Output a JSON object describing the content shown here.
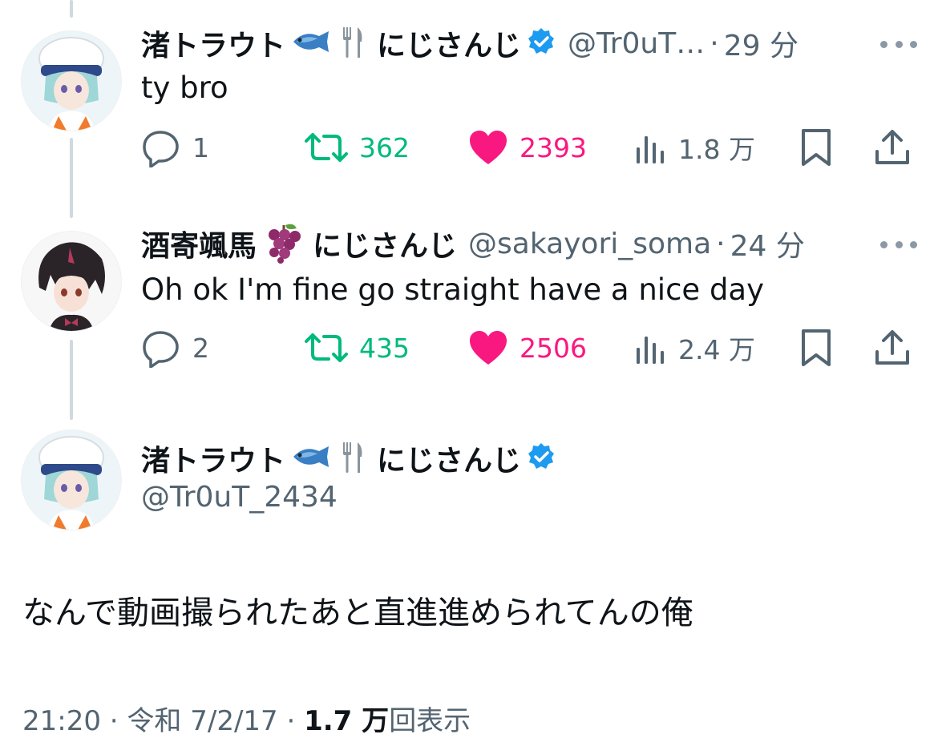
{
  "thread": [
    {
      "display_name": "渚トラウト",
      "suffix": "にじさんじ",
      "handle": "@Tr0uT…",
      "separator": "·",
      "time": "29 分",
      "text": "ty bro",
      "reply_count": "1",
      "retweet_count": "362",
      "like_count": "2393",
      "view_count": "1.8 万",
      "verified": true,
      "name_emojis": [
        "fish-icon",
        "fork-knife-icon"
      ]
    },
    {
      "display_name": "酒寄颯馬",
      "suffix": "にじさんじ",
      "handle": "@sakayori_soma",
      "separator": "·",
      "time": "24 分",
      "text": "Oh ok I'm fine go straight have a nice day",
      "reply_count": "2",
      "retweet_count": "435",
      "like_count": "2506",
      "view_count": "2.4 万",
      "verified": false,
      "name_emojis": [
        "grapes-icon"
      ]
    }
  ],
  "main_tweet": {
    "display_name": "渚トラウト",
    "suffix": "にじさんじ",
    "handle": "@Tr0uT_2434",
    "text": "なんで動画撮られたあと直進進められてんの俺",
    "footer_time": "21:20",
    "footer_sep1": "·",
    "footer_date": "令和 7/2/17",
    "footer_sep2": "·",
    "footer_views": "1.7 万",
    "footer_views_label": "回表示"
  },
  "colors": {
    "text": "#0f1419",
    "secondary": "#536471",
    "retweet": "#00ba7c",
    "like": "#f91880",
    "verified": "#1d9bf0",
    "thread_line": "#cfd9de"
  }
}
